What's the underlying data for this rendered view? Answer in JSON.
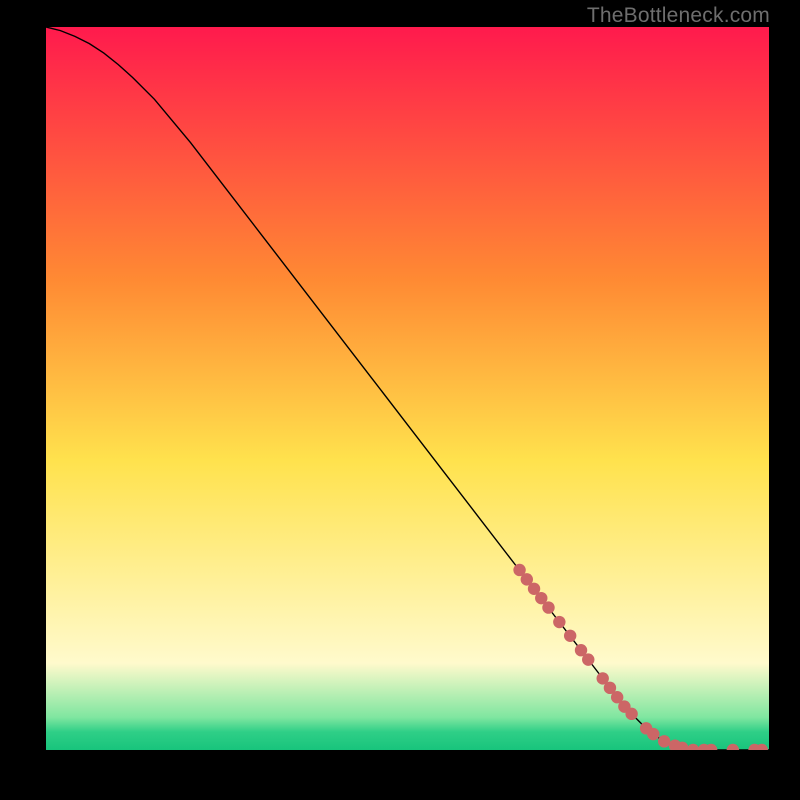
{
  "watermark": "TheBottleneck.com",
  "colors": {
    "bg": "#000000",
    "line": "#000000",
    "marker": "#cc6666",
    "grad_top": "#ff1a4d",
    "grad_mid_upper": "#ff8a33",
    "grad_mid": "#ffe24d",
    "grad_lower": "#fffacc",
    "grad_green1": "#7fe6a0",
    "grad_green2": "#2fcf87",
    "grad_green3": "#18c47c"
  },
  "chart_data": {
    "type": "line",
    "title": "",
    "xlabel": "",
    "ylabel": "",
    "xlim": [
      0,
      1
    ],
    "ylim": [
      0,
      1
    ],
    "series": [
      {
        "name": "curve",
        "x": [
          0.0,
          0.02,
          0.04,
          0.06,
          0.08,
          0.1,
          0.12,
          0.15,
          0.2,
          0.25,
          0.3,
          0.35,
          0.4,
          0.45,
          0.5,
          0.55,
          0.6,
          0.65,
          0.7,
          0.75,
          0.8,
          0.83,
          0.85,
          0.87,
          0.9,
          0.93,
          0.96,
          1.0
        ],
        "y": [
          1.0,
          0.995,
          0.987,
          0.977,
          0.964,
          0.948,
          0.93,
          0.9,
          0.84,
          0.775,
          0.71,
          0.645,
          0.58,
          0.515,
          0.45,
          0.385,
          0.32,
          0.255,
          0.19,
          0.125,
          0.06,
          0.03,
          0.015,
          0.006,
          0.0,
          0.0,
          0.0,
          0.0
        ]
      }
    ],
    "markers": {
      "name": "highlight-dots",
      "x": [
        0.655,
        0.665,
        0.675,
        0.685,
        0.695,
        0.71,
        0.725,
        0.74,
        0.75,
        0.77,
        0.78,
        0.79,
        0.8,
        0.81,
        0.83,
        0.84,
        0.855,
        0.87,
        0.88,
        0.895,
        0.91,
        0.92,
        0.95,
        0.98,
        0.99
      ],
      "y": [
        0.249,
        0.236,
        0.223,
        0.21,
        0.197,
        0.177,
        0.158,
        0.138,
        0.125,
        0.099,
        0.086,
        0.073,
        0.06,
        0.05,
        0.03,
        0.022,
        0.012,
        0.006,
        0.003,
        0.0,
        0.0,
        0.0,
        0.0,
        0.0,
        0.0
      ]
    }
  }
}
